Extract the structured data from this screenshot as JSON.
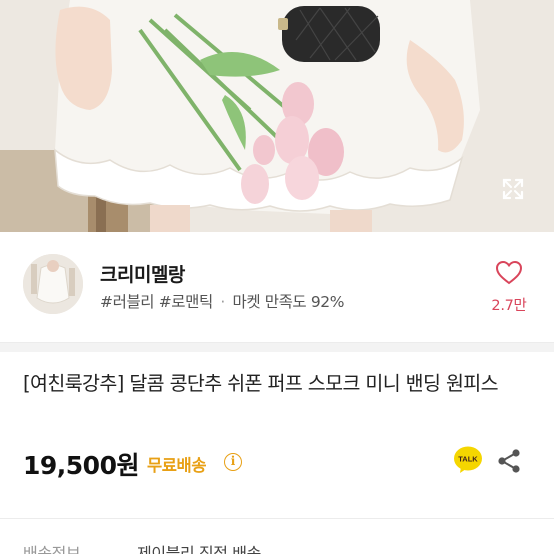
{
  "product_image": {
    "alt_icon": "expand-icon",
    "current_index": 1,
    "total": 1
  },
  "seller": {
    "name": "크리미멜랑",
    "tags": [
      "#러블리",
      "#로맨틱"
    ],
    "separator": "·",
    "satisfaction": "마켓 만족도 92%",
    "like_icon": "heart-outline-icon",
    "like_count": "2.7만"
  },
  "product": {
    "title": "[여친룩강추] 달콤 콩단추 쉬폰 퍼프 스모크 미니 밴딩 원피스",
    "price": "19,500원",
    "shipping_badge": "무료배송",
    "info_symbol": "i",
    "talk_label": "TALK",
    "share_icon": "share-icon"
  },
  "partial_row": {
    "label": "배송정보",
    "value": "제이블리 직접 배송"
  },
  "colors": {
    "accent_pink": "#d9455b",
    "shipping_orange": "#e8a015",
    "talk_yellow": "#f5d600"
  }
}
